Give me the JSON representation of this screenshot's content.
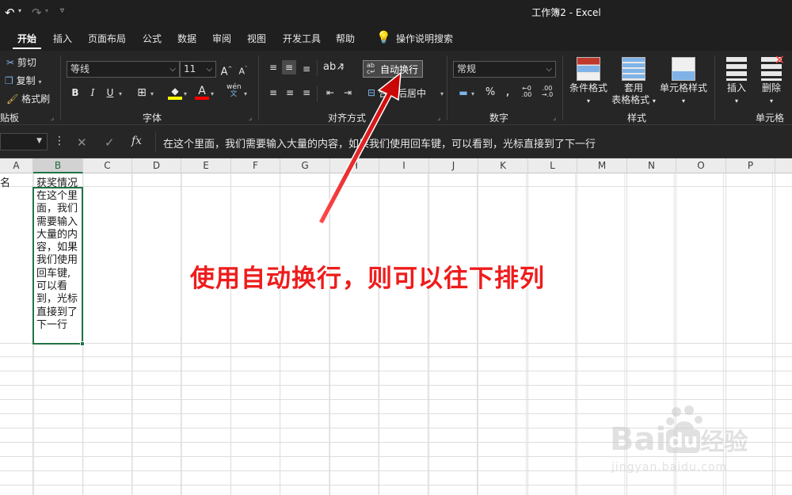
{
  "window": {
    "title": "工作簿2 - Excel"
  },
  "quick_access": {
    "undo_icon": "undo-icon",
    "redo_icon": "redo-icon",
    "customize_icon": "customize-icon"
  },
  "tabs": [
    "开始",
    "插入",
    "页面布局",
    "公式",
    "数据",
    "审阅",
    "视图",
    "开发工具",
    "帮助"
  ],
  "active_tab": "开始",
  "tell_me": "操作说明搜索",
  "ribbon": {
    "clipboard": {
      "cut": "剪切",
      "copy": "复制",
      "format_painter": "格式刷",
      "label": "贴板"
    },
    "font": {
      "name": "等线",
      "size": "11",
      "bold": "B",
      "italic": "I",
      "underline": "U",
      "grow": "A",
      "shrink": "A",
      "phonetic": "wén",
      "label": "字体"
    },
    "alignment": {
      "wrap_text": "自动换行",
      "merge_center": "合并后居中",
      "label": "对齐方式"
    },
    "number": {
      "format": "常规",
      "percent": "%",
      "comma": ",",
      "label": "数字"
    },
    "styles": {
      "conditional": "条件格式",
      "table_line1": "套用",
      "table_line2": "表格格式",
      "cell_styles": "单元格样式",
      "label": "样式"
    },
    "cells": {
      "insert": "插入",
      "delete": "删除",
      "label": "单元格"
    }
  },
  "formula_bar": {
    "cancel_icon": "✕",
    "enter_icon": "✓",
    "fx": "fx",
    "content": "在这个里面，我们需要输入大量的内容，如果我们使用回车键，可以看到，光标直接到了下一行"
  },
  "columns": [
    "A",
    "B",
    "C",
    "D",
    "E",
    "F",
    "G",
    "H",
    "I",
    "J",
    "K",
    "L",
    "M",
    "N",
    "O",
    "P"
  ],
  "selected_column": "B",
  "cells": {
    "a1": "名",
    "b1": "获奖情况",
    "b2_lines": [
      "在这个里",
      "面，我们",
      "需要输入",
      "大量的内",
      "容，如果",
      "我们使用",
      "回车键,",
      "可以看",
      "到，光标",
      "直接到了",
      "下一行"
    ]
  },
  "annotation": "使用自动换行，则可以往下排列",
  "watermark": {
    "brand": "Bai",
    "brand2": "du",
    "brand_cn": "经验",
    "sub": "jingyan.baidu.com"
  },
  "colors": {
    "accent_green": "#217346",
    "annotation_red": "#ee1c1c",
    "ribbon_bg": "#262626"
  }
}
